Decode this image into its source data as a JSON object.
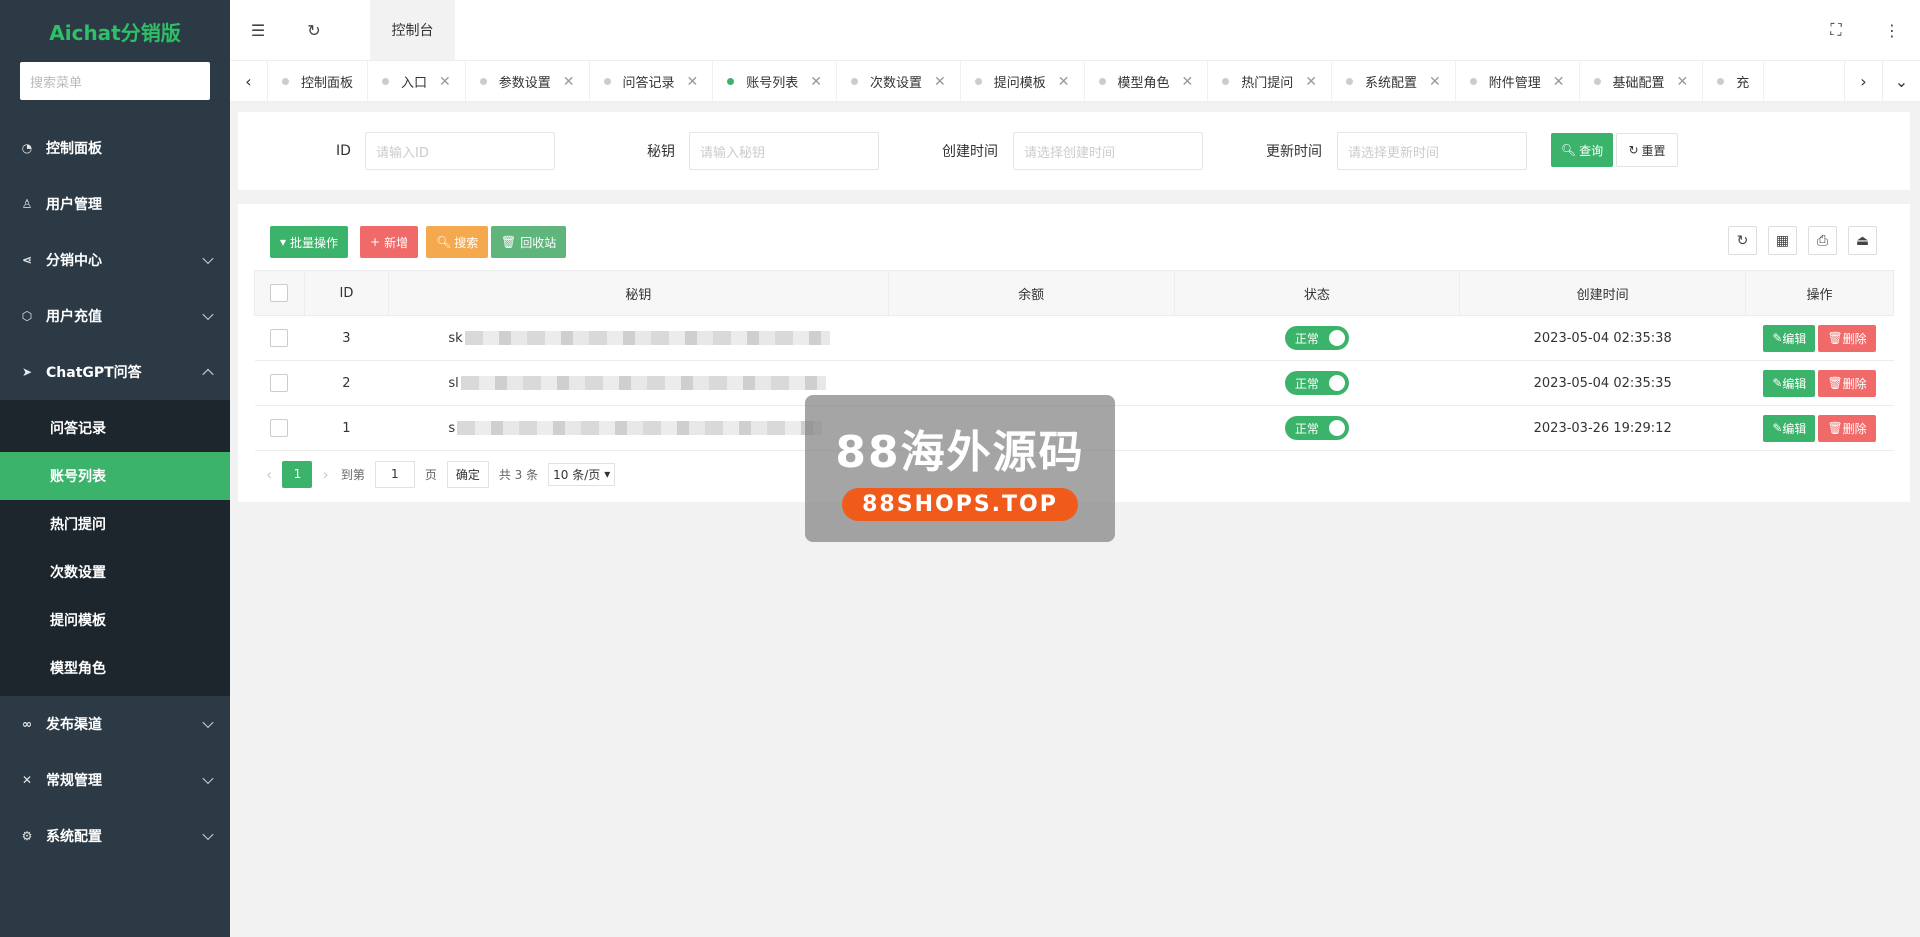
{
  "sidebar": {
    "brand": "Aichat分销版",
    "search_placeholder": "搜索菜单",
    "items": [
      {
        "label": "控制面板",
        "icon": "dashboard-icon",
        "expandable": false
      },
      {
        "label": "用户管理",
        "icon": "user-icon",
        "expandable": false
      },
      {
        "label": "分销中心",
        "icon": "share-icon",
        "expandable": true
      },
      {
        "label": "用户充值",
        "icon": "box-icon",
        "expandable": true
      },
      {
        "label": "ChatGPT问答",
        "icon": "send-icon",
        "expandable": true,
        "expanded": true
      },
      {
        "label": "发布渠道",
        "icon": "link-icon",
        "expandable": true
      },
      {
        "label": "常规管理",
        "icon": "tools-icon",
        "expandable": true
      },
      {
        "label": "系统配置",
        "icon": "gear-icon",
        "expandable": true
      }
    ],
    "submenu": [
      {
        "label": "问答记录"
      },
      {
        "label": "账号列表",
        "active": true
      },
      {
        "label": "热门提问"
      },
      {
        "label": "次数设置"
      },
      {
        "label": "提问模板"
      },
      {
        "label": "模型角色"
      }
    ]
  },
  "topbar": {
    "tab_label": "控制台"
  },
  "tabs": [
    {
      "label": "控制面板",
      "closable": false
    },
    {
      "label": "入口",
      "closable": true
    },
    {
      "label": "参数设置",
      "closable": true
    },
    {
      "label": "问答记录",
      "closable": true
    },
    {
      "label": "账号列表",
      "closable": true,
      "active": true
    },
    {
      "label": "次数设置",
      "closable": true
    },
    {
      "label": "提问模板",
      "closable": true
    },
    {
      "label": "模型角色",
      "closable": true
    },
    {
      "label": "热门提问",
      "closable": true
    },
    {
      "label": "系统配置",
      "closable": true
    },
    {
      "label": "附件管理",
      "closable": true
    },
    {
      "label": "基础配置",
      "closable": true
    },
    {
      "label": "充",
      "closable": false
    }
  ],
  "filter": {
    "id_label": "ID",
    "id_placeholder": "请输入ID",
    "key_label": "秘钥",
    "key_placeholder": "请输入秘钥",
    "created_label": "创建时间",
    "created_placeholder": "请选择创建时间",
    "updated_label": "更新时间",
    "updated_placeholder": "请选择更新时间",
    "query_label": "查询",
    "reset_label": "重置"
  },
  "toolbar": {
    "batch_label": "批量操作",
    "add_label": "新增",
    "search_label": "搜索",
    "recycle_label": "回收站"
  },
  "table": {
    "headers": [
      "ID",
      "秘钥",
      "余额",
      "状态",
      "创建时间",
      "操作"
    ],
    "rows": [
      {
        "id": "3",
        "key_prefix": "sk",
        "balance": "",
        "status": "正常",
        "created": "2023-05-04 02:35:38"
      },
      {
        "id": "2",
        "key_prefix": "sl",
        "balance": "",
        "status": "正常",
        "created": "2023-05-04 02:35:35"
      },
      {
        "id": "1",
        "key_prefix": "s",
        "balance": "",
        "status": "正常",
        "created": "2023-03-26 19:29:12"
      }
    ],
    "edit_label": "编辑",
    "delete_label": "删除"
  },
  "pager": {
    "current_page": "1",
    "goto_label": "到第",
    "goto_value": "1",
    "page_unit": "页",
    "confirm_label": "确定",
    "total_label": "共 3 条",
    "page_size": "10 条/页"
  },
  "watermark": {
    "title": "88海外源码",
    "subtitle": "88SHOPS.TOP"
  },
  "colors": {
    "sidebar_bg": "#2b3a45",
    "accent_green": "#3cb36a",
    "danger_red": "#f06a6a",
    "warning_orange": "#f5a94e"
  }
}
